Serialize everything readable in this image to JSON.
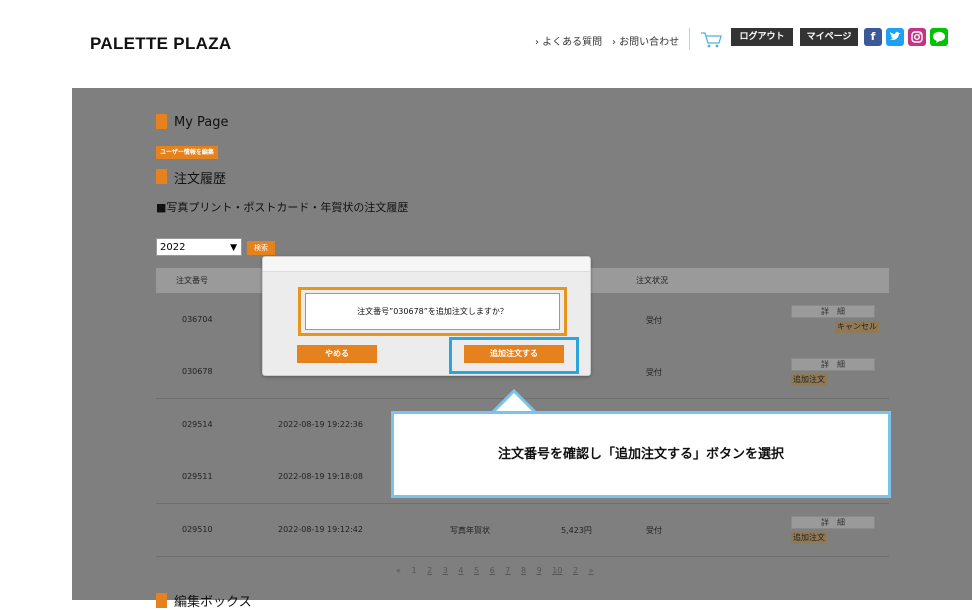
{
  "header": {
    "logo": "PALETTE PLAZA",
    "nav": [
      "› よくある質問",
      "› お問い合わせ"
    ],
    "logout_label": "ログアウト",
    "mypage_label": "マイページ",
    "sns": [
      {
        "name": "facebook",
        "glyph": "f",
        "color": "#3b5998"
      },
      {
        "name": "twitter",
        "glyph": "t",
        "color": "#1da1f2"
      },
      {
        "name": "instagram",
        "glyph": "◎",
        "color": "#c13584"
      },
      {
        "name": "line",
        "glyph": "LINE",
        "color": "#00c300"
      }
    ]
  },
  "mypage": {
    "title": "My Page",
    "edit_user_label": "ユーザー情報を編集",
    "history_title": "注文履歴",
    "history_subtitle": "■写真プリント・ポストカード・年賀状の注文履歴",
    "year_select": "2022",
    "search_label": "検索"
  },
  "table": {
    "headers": [
      "注文番号",
      "注文状況"
    ],
    "rows": [
      {
        "id": "036704",
        "date": "",
        "product": "",
        "price": "",
        "status": "受付",
        "detail": "詳　細",
        "action": "キャンセル"
      },
      {
        "id": "030678",
        "date": "",
        "product": "",
        "price": "",
        "status": "受付",
        "detail": "詳　細",
        "action": "追加注文"
      },
      {
        "id": "029514",
        "date": "2022-08-19 19:22:36",
        "product": "",
        "price": "",
        "status": "",
        "detail": "",
        "action": ""
      },
      {
        "id": "029511",
        "date": "2022-08-19 19:18:08",
        "product": "",
        "price": "",
        "status": "",
        "detail": "",
        "action": ""
      },
      {
        "id": "029510",
        "date": "2022-08-19 19:12:42",
        "product": "写真年賀状",
        "price": "5,423円",
        "status": "受付",
        "detail": "詳　細",
        "action": "追加注文"
      }
    ]
  },
  "pager": {
    "prev": "«",
    "pages": [
      "1",
      "2",
      "3",
      "4",
      "5",
      "6",
      "7",
      "8",
      "9",
      "10",
      "2",
      "»"
    ]
  },
  "bottom_section": "編集ボックス",
  "modal": {
    "message": "注文番号”030678”を追加注文しますか？",
    "cancel_label": "やめる",
    "confirm_label": "追加注文する"
  },
  "callout": {
    "text": "注文番号を確認し「追加注文する」ボタンを選択"
  },
  "colors": {
    "accent": "#e6821e",
    "highlight": "#2ca3dc",
    "overlay": "#7f7f7f"
  }
}
